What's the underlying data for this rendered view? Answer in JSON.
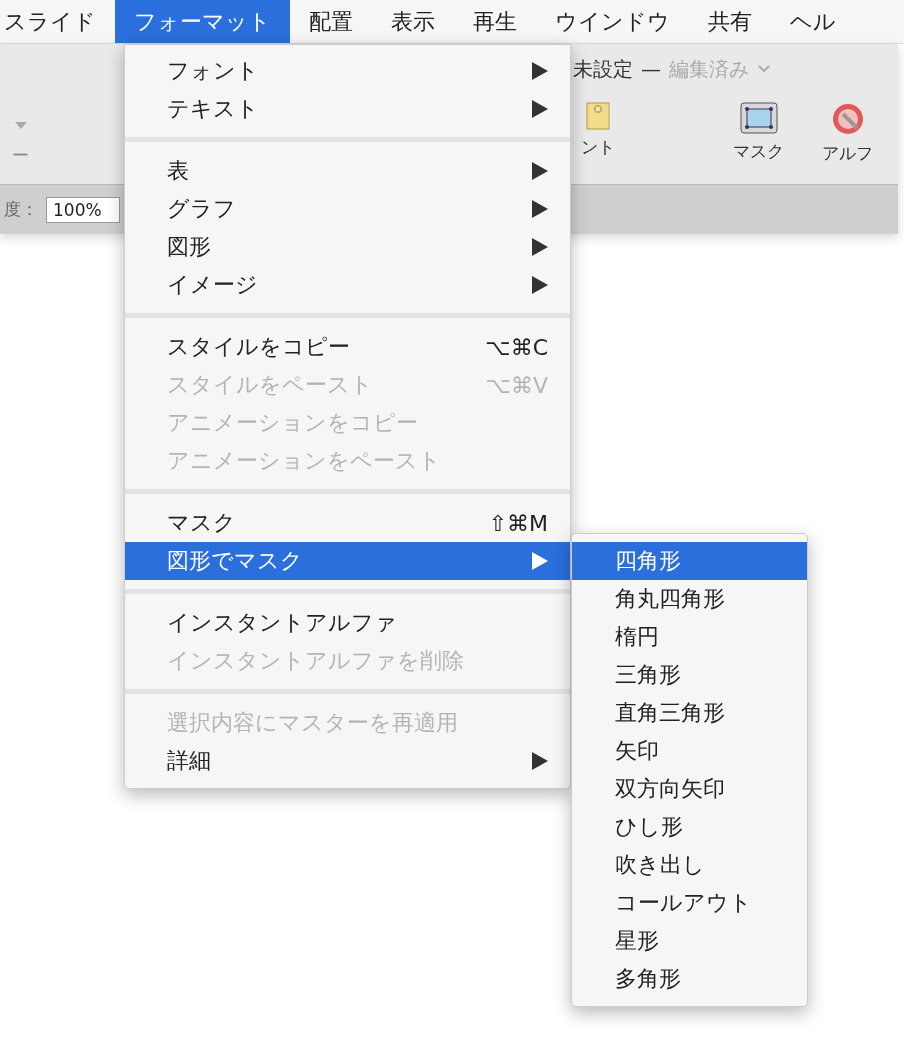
{
  "menu_bar": [
    {
      "label": "スライド",
      "selected": false
    },
    {
      "label": "フォーマット",
      "selected": true
    },
    {
      "label": "配置",
      "selected": false
    },
    {
      "label": "表示",
      "selected": false
    },
    {
      "label": "再生",
      "selected": false
    },
    {
      "label": "ウインドウ",
      "selected": false
    },
    {
      "label": "共有",
      "selected": false
    },
    {
      "label": "ヘル",
      "selected": false
    }
  ],
  "window": {
    "title": "未設定",
    "title_dash": "—",
    "status": "編集済み"
  },
  "toolbar": {
    "left_label": "ー",
    "buttons": [
      {
        "kind": "comment",
        "label": "ント"
      },
      {
        "kind": "mask",
        "label": "マスク"
      },
      {
        "kind": "alpha",
        "label": "アルフ"
      }
    ]
  },
  "format_bar": {
    "zoom_label": "度：",
    "zoom_value": "100%"
  },
  "format_menu": {
    "sections": [
      [
        {
          "label": "フォント",
          "submenu": true,
          "disabled": false,
          "selected": false
        },
        {
          "label": "テキスト",
          "submenu": true,
          "disabled": false,
          "selected": false
        }
      ],
      [
        {
          "label": "表",
          "submenu": true,
          "disabled": false,
          "selected": false
        },
        {
          "label": "グラフ",
          "submenu": true,
          "disabled": false,
          "selected": false
        },
        {
          "label": "図形",
          "submenu": true,
          "disabled": false,
          "selected": false
        },
        {
          "label": "イメージ",
          "submenu": true,
          "disabled": false,
          "selected": false
        }
      ],
      [
        {
          "label": "スタイルをコピー",
          "shortcut": "⌥⌘C",
          "submenu": false,
          "disabled": false,
          "selected": false
        },
        {
          "label": "スタイルをペースト",
          "shortcut": "⌥⌘V",
          "submenu": false,
          "disabled": true,
          "selected": false
        },
        {
          "label": "アニメーションをコピー",
          "submenu": false,
          "disabled": true,
          "selected": false
        },
        {
          "label": "アニメーションをペースト",
          "submenu": false,
          "disabled": true,
          "selected": false
        }
      ],
      [
        {
          "label": "マスク",
          "shortcut": "⇧⌘M",
          "submenu": false,
          "disabled": false,
          "selected": false
        },
        {
          "label": "図形でマスク",
          "submenu": true,
          "disabled": false,
          "selected": true
        }
      ],
      [
        {
          "label": "インスタントアルファ",
          "submenu": false,
          "disabled": false,
          "selected": false
        },
        {
          "label": "インスタントアルファを削除",
          "submenu": false,
          "disabled": true,
          "selected": false
        }
      ],
      [
        {
          "label": "選択内容にマスターを再適用",
          "submenu": false,
          "disabled": true,
          "selected": false
        },
        {
          "label": "詳細",
          "submenu": true,
          "disabled": false,
          "selected": false
        }
      ]
    ]
  },
  "shape_submenu": [
    {
      "label": "四角形",
      "selected": true
    },
    {
      "label": "角丸四角形",
      "selected": false
    },
    {
      "label": "楕円",
      "selected": false
    },
    {
      "label": "三角形",
      "selected": false
    },
    {
      "label": "直角三角形",
      "selected": false
    },
    {
      "label": "矢印",
      "selected": false
    },
    {
      "label": "双方向矢印",
      "selected": false
    },
    {
      "label": "ひし形",
      "selected": false
    },
    {
      "label": "吹き出し",
      "selected": false
    },
    {
      "label": "コールアウト",
      "selected": false
    },
    {
      "label": "星形",
      "selected": false
    },
    {
      "label": "多角形",
      "selected": false
    }
  ]
}
